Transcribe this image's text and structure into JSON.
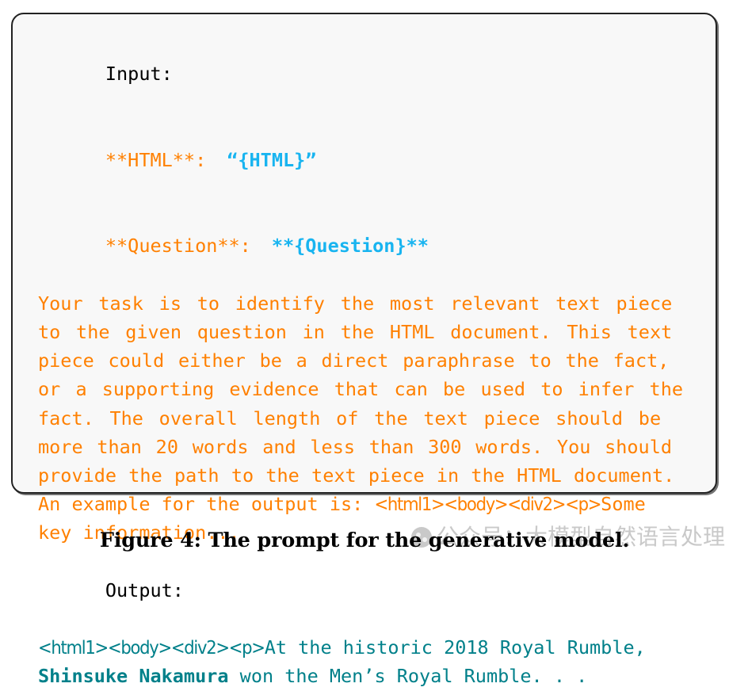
{
  "figure": {
    "caption": "Figure 4: The prompt for the generative model."
  },
  "watermark": {
    "logo_icon": "wechat-official-account-logo-icon",
    "text": "公众号：大模型自然语言处理"
  },
  "colors": {
    "orange": "#FF8000",
    "cyan": "#18B4F0",
    "teal": "#00808A",
    "black": "#000000",
    "box_background": "#F8F8F8",
    "box_border": "#222222",
    "watermark_grey": "#C9C9C9"
  },
  "prompt": {
    "input_label": "Input:",
    "html_field": {
      "key": "**HTML**:",
      "value": "“{HTML}”"
    },
    "question_field": {
      "key": "**Question**:",
      "value": "**{Question}**"
    },
    "instruction_lines": [
      "Your task is to identify the most relevant text piece",
      "to the given question in the HTML document. This text",
      "piece could either be a direct paraphrase to the fact,",
      "or a supporting evidence that can be used to infer the",
      "fact. The overall length of the text piece should be",
      "more than 20 words and less than 300 words. You should",
      "provide the path to the text piece in the HTML document."
    ],
    "example_line_prefix": "An example for the output is: ",
    "example_line_tag": "<html1><body><div2><p>",
    "example_line_suffix": "Some",
    "example_line_last": "key information...",
    "output_label": "Output:",
    "output_tag": "<html1><body><div2><p>",
    "output_text_before": "At the historic 2018 Royal Rumble,",
    "output_bold": "Shinsuke Nakamura",
    "output_text_after": " won the Men’s Royal Rumble. . ."
  }
}
